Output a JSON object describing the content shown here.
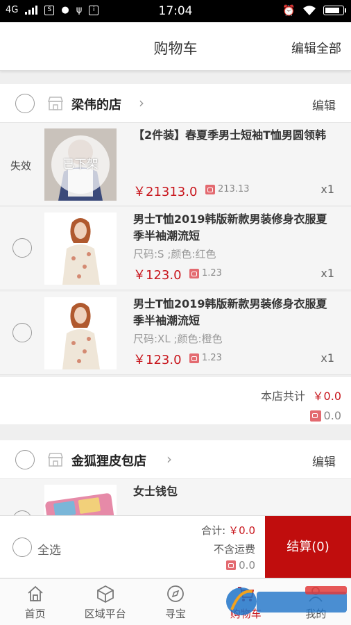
{
  "status_bar": {
    "network": "4G",
    "time": "17:04"
  },
  "header": {
    "title": "购物车",
    "edit_all": "编辑全部"
  },
  "stores": [
    {
      "name": "梁伟的店",
      "edit": "编辑",
      "items": [
        {
          "name": "【2件装】春夏季男士短袖T恤男圆领韩",
          "status": "失效",
          "badge": "已下架",
          "spec": "",
          "price": "￥21313.0",
          "coin": "213.13",
          "qty": "x1"
        },
        {
          "name": "男士T恤2019韩版新款男装修身衣服夏季半袖潮流短",
          "spec": "尺码:S ;颜色:红色",
          "price": "￥123.0",
          "coin": "1.23",
          "qty": "x1"
        },
        {
          "name": "男士T恤2019韩版新款男装修身衣服夏季半袖潮流短",
          "spec": "尺码:XL ;颜色:橙色",
          "price": "￥123.0",
          "coin": "1.23",
          "qty": "x1"
        }
      ],
      "subtotal_label": "本店共计",
      "subtotal_value": "￥0.0",
      "subtotal_coin": "0.0"
    },
    {
      "name": "金狐狸皮包店",
      "edit": "编辑",
      "items": [
        {
          "name": "女士钱包"
        }
      ]
    }
  ],
  "checkout": {
    "select_all": "全选",
    "total_label": "合计:",
    "total_value": "￥0.0",
    "shipping_note": "不含运费",
    "coin": "0.0",
    "pay_button": "结算(0)"
  },
  "tabs": [
    {
      "label": "首页",
      "icon": "home-icon"
    },
    {
      "label": "区域平台",
      "icon": "cube-icon"
    },
    {
      "label": "寻宝",
      "icon": "compass-icon"
    },
    {
      "label": "购物车",
      "icon": "cart-icon",
      "active": true
    },
    {
      "label": "我的",
      "icon": "user-icon"
    }
  ],
  "colors": {
    "accent": "#c8161d",
    "pay_button": "#c00d0d"
  }
}
